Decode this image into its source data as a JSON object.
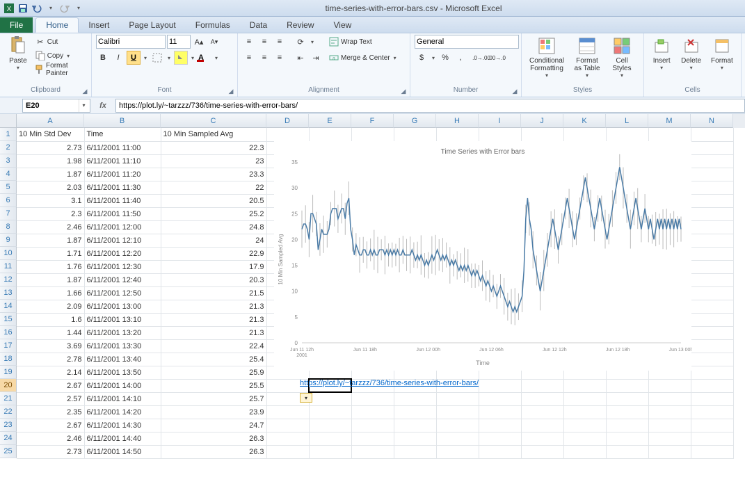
{
  "window": {
    "title": "time-series-with-error-bars.csv - Microsoft Excel"
  },
  "tabs": {
    "file": "File",
    "list": [
      "Home",
      "Insert",
      "Page Layout",
      "Formulas",
      "Data",
      "Review",
      "View"
    ],
    "active": "Home"
  },
  "ribbon": {
    "clipboard": {
      "title": "Clipboard",
      "paste": "Paste",
      "cut": "Cut",
      "copy": "Copy",
      "format_painter": "Format Painter"
    },
    "font": {
      "title": "Font",
      "name": "Calibri",
      "size": "11"
    },
    "alignment": {
      "title": "Alignment",
      "wrap": "Wrap Text",
      "merge": "Merge & Center"
    },
    "number": {
      "title": "Number",
      "format": "General"
    },
    "styles": {
      "title": "Styles",
      "cond": "Conditional Formatting",
      "table": "Format as Table",
      "cell": "Cell Styles"
    },
    "cells": {
      "title": "Cells",
      "insert": "Insert",
      "delete": "Delete",
      "format": "Format"
    }
  },
  "namebox": "E20",
  "formula": "https://plot.ly/~tarzzz/736/time-series-with-error-bars/",
  "columns": [
    "A",
    "B",
    "C",
    "D",
    "E",
    "F",
    "G",
    "H",
    "I",
    "J",
    "K",
    "L",
    "M",
    "N"
  ],
  "headers": {
    "A": "10 Min Std Dev",
    "B": "Time",
    "C": "10 Min Sampled Avg"
  },
  "rows": [
    {
      "n": 2,
      "a": "2.73",
      "b": "6/11/2001 11:00",
      "c": "22.3"
    },
    {
      "n": 3,
      "a": "1.98",
      "b": "6/11/2001 11:10",
      "c": "23"
    },
    {
      "n": 4,
      "a": "1.87",
      "b": "6/11/2001 11:20",
      "c": "23.3"
    },
    {
      "n": 5,
      "a": "2.03",
      "b": "6/11/2001 11:30",
      "c": "22"
    },
    {
      "n": 6,
      "a": "3.1",
      "b": "6/11/2001 11:40",
      "c": "20.5"
    },
    {
      "n": 7,
      "a": "2.3",
      "b": "6/11/2001 11:50",
      "c": "25.2"
    },
    {
      "n": 8,
      "a": "2.46",
      "b": "6/11/2001 12:00",
      "c": "24.8"
    },
    {
      "n": 9,
      "a": "1.87",
      "b": "6/11/2001 12:10",
      "c": "24"
    },
    {
      "n": 10,
      "a": "1.71",
      "b": "6/11/2001 12:20",
      "c": "22.9"
    },
    {
      "n": 11,
      "a": "1.76",
      "b": "6/11/2001 12:30",
      "c": "17.9"
    },
    {
      "n": 12,
      "a": "1.87",
      "b": "6/11/2001 12:40",
      "c": "20.3"
    },
    {
      "n": 13,
      "a": "1.66",
      "b": "6/11/2001 12:50",
      "c": "21.5"
    },
    {
      "n": 14,
      "a": "2.09",
      "b": "6/11/2001 13:00",
      "c": "21.3"
    },
    {
      "n": 15,
      "a": "1.6",
      "b": "6/11/2001 13:10",
      "c": "21.3"
    },
    {
      "n": 16,
      "a": "1.44",
      "b": "6/11/2001 13:20",
      "c": "21.3"
    },
    {
      "n": 17,
      "a": "3.69",
      "b": "6/11/2001 13:30",
      "c": "22.4"
    },
    {
      "n": 18,
      "a": "2.78",
      "b": "6/11/2001 13:40",
      "c": "25.4"
    },
    {
      "n": 19,
      "a": "2.14",
      "b": "6/11/2001 13:50",
      "c": "25.9"
    },
    {
      "n": 20,
      "a": "2.67",
      "b": "6/11/2001 14:00",
      "c": "25.5",
      "link": "https://plot.ly/~tarzzz/736/time-series-with-error-bars/"
    },
    {
      "n": 21,
      "a": "2.57",
      "b": "6/11/2001 14:10",
      "c": "25.7"
    },
    {
      "n": 22,
      "a": "2.35",
      "b": "6/11/2001 14:20",
      "c": "23.9"
    },
    {
      "n": 23,
      "a": "2.67",
      "b": "6/11/2001 14:30",
      "c": "24.7"
    },
    {
      "n": 24,
      "a": "2.46",
      "b": "6/11/2001 14:40",
      "c": "26.3"
    },
    {
      "n": 25,
      "a": "2.73",
      "b": "6/11/2001 14:50",
      "c": "26.3"
    }
  ],
  "chart_data": {
    "type": "line",
    "title": "Time Series with Error bars",
    "xlabel": "Time",
    "ylabel": "10 Min Sampled Avg",
    "ylim": [
      0,
      35
    ],
    "yticks": [
      0,
      5,
      10,
      15,
      20,
      25,
      30,
      35
    ],
    "xticks": [
      "Jun 11 12h 2001",
      "Jun 11 18h",
      "Jun 12 00h",
      "Jun 12 06h",
      "Jun 12 12h",
      "Jun 12 18h",
      "Jun 13 00h"
    ],
    "series": [
      {
        "name": "10 Min Sampled Avg",
        "color": "#4a7ba6",
        "y": [
          22,
          23,
          23,
          22,
          20,
          25,
          25,
          24,
          23,
          18,
          20,
          22,
          21,
          21,
          21,
          22,
          25,
          26,
          26,
          26,
          24,
          25,
          26,
          26,
          24,
          27,
          28,
          22,
          20,
          17,
          19,
          18,
          17,
          17,
          18,
          18,
          17,
          17,
          18,
          17,
          18,
          17,
          17,
          18,
          18,
          18,
          17,
          18,
          17,
          18,
          17,
          18,
          17,
          18,
          17,
          17,
          18,
          17,
          17,
          17,
          17,
          18,
          17,
          16,
          17,
          16,
          17,
          16,
          15,
          16,
          15,
          16,
          17,
          16,
          17,
          18,
          17,
          16,
          17,
          16,
          17,
          16,
          15,
          16,
          15,
          16,
          15,
          14,
          15,
          14,
          15,
          14,
          15,
          14,
          13,
          14,
          13,
          14,
          13,
          12,
          13,
          12,
          11,
          12,
          11,
          10,
          11,
          10,
          9,
          10,
          11,
          10,
          9,
          8,
          7,
          8,
          7,
          6,
          7,
          6,
          7,
          8,
          9,
          14,
          24,
          28,
          24,
          22,
          18,
          16,
          14,
          12,
          10,
          12,
          14,
          16,
          18,
          20,
          22,
          24,
          22,
          20,
          18,
          20,
          22,
          24,
          26,
          28,
          26,
          24,
          22,
          20,
          22,
          24,
          26,
          28,
          30,
          32,
          30,
          28,
          26,
          24,
          22,
          24,
          26,
          28,
          26,
          24,
          22,
          20,
          22,
          24,
          26,
          28,
          30,
          32,
          34,
          32,
          30,
          28,
          26,
          24,
          22,
          24,
          26,
          28,
          26,
          24,
          22,
          24,
          26,
          24,
          22,
          24,
          22,
          20,
          22,
          24,
          22,
          24,
          22,
          24,
          22,
          24,
          22,
          24,
          22,
          24,
          22,
          24,
          22
        ]
      }
    ]
  }
}
